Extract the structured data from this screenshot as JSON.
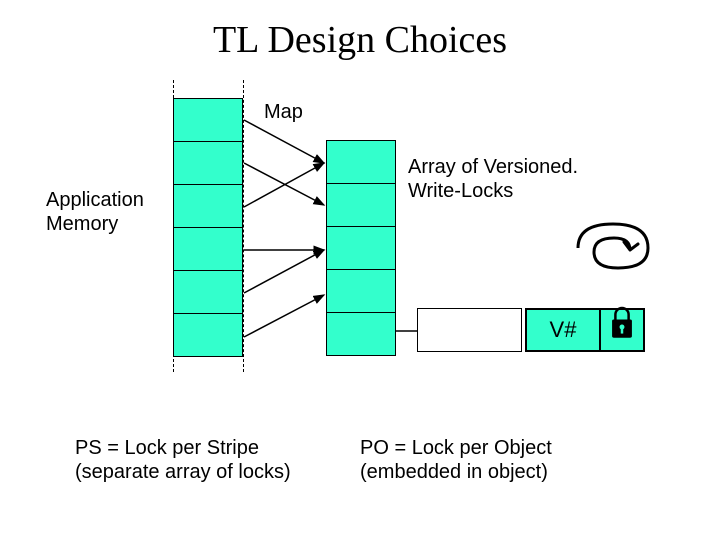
{
  "title": "TL Design Choices",
  "map_label": "Map",
  "appmem_label_line1": "Application",
  "appmem_label_line2": "Memory",
  "array_label_line1": "Array of Versioned.",
  "array_label_line2": "Write-Locks",
  "vhash_label": "V#",
  "ps_label_line1": "PS = Lock per Stripe",
  "ps_label_line2": "(separate array of locks)",
  "po_label_line1": "PO = Lock per Object",
  "po_label_line2": "(embedded in object)",
  "colors": {
    "cell_fill": "#33ffcc",
    "stroke": "#000000"
  },
  "left_column_cells": 6,
  "right_column_cells": 5
}
